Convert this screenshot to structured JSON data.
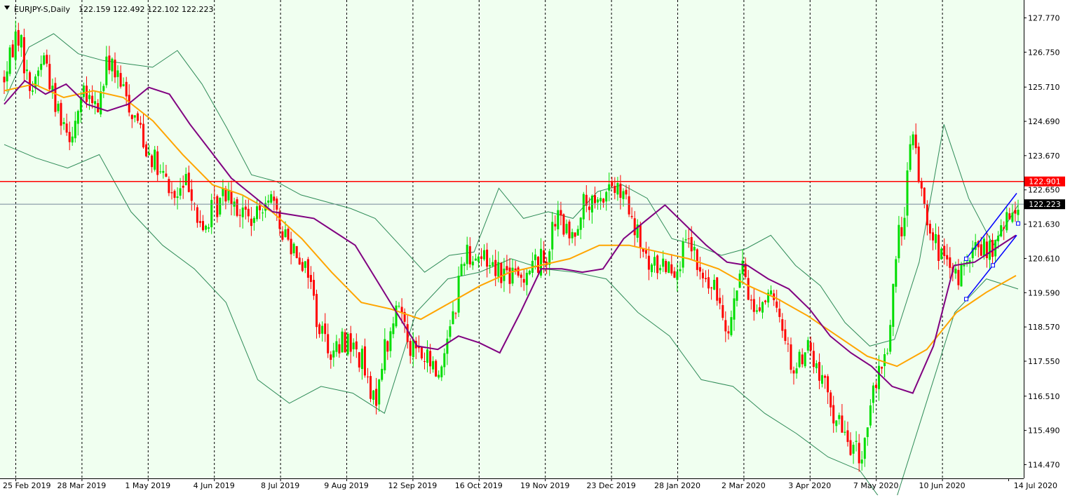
{
  "header": {
    "symbol": "EURJPY-S,Daily",
    "ohlc": "122.159 122.492 122.102 122.223",
    "menu_icon": "triangle-down-icon"
  },
  "colors": {
    "background": "#f0fff0",
    "grid": "#000000",
    "candle_up": "#00dd00",
    "candle_down": "#ff0000",
    "ma_fast": "#800080",
    "ma_slow": "#ffa500",
    "bollinger": "#2e8b57",
    "resistance": "#ff0000",
    "channel": "#0000ff",
    "price_tag": "#000000"
  },
  "chart_data": {
    "type": "candlestick",
    "instrument": "EURJPY-S",
    "timeframe": "Daily",
    "y_ticks": [
      "127.770",
      "126.750",
      "125.710",
      "124.690",
      "123.670",
      "122.650",
      "121.630",
      "120.610",
      "119.590",
      "118.570",
      "117.550",
      "116.510",
      "115.490",
      "114.470"
    ],
    "ylim": [
      114.0,
      128.3
    ],
    "x_ticks": [
      "25 Feb 2019",
      "28 Mar 2019",
      "1 May 2019",
      "4 Jun 2019",
      "8 Jul 2019",
      "9 Aug 2019",
      "12 Sep 2019",
      "16 Oct 2019",
      "19 Nov 2019",
      "23 Dec 2019",
      "28 Jan 2020",
      "2 Mar 2020",
      "3 Apr 2020",
      "7 May 2020",
      "10 Jun 2020",
      "14 Jul 2020"
    ],
    "grid": "vertical dotted",
    "resistance_level": "122.901",
    "current_price": "122.223",
    "price_path": [
      126.0,
      127.3,
      125.7,
      126.6,
      125.1,
      124.4,
      125.4,
      125.1,
      126.5,
      125.6,
      124.8,
      123.8,
      123.0,
      122.4,
      122.9,
      121.4,
      122.1,
      122.7,
      122.0,
      121.7,
      122.6,
      121.5,
      121.0,
      120.3,
      118.5,
      117.8,
      118.2,
      117.7,
      116.3,
      118.0,
      119.2,
      118.0,
      117.6,
      117.2,
      118.9,
      120.8,
      120.7,
      120.5,
      120.2,
      120.0,
      120.4,
      120.6,
      121.8,
      121.2,
      122.2,
      122.1,
      122.8,
      122.4,
      121.3,
      120.3,
      120.5,
      120.4,
      121.0,
      120.0,
      119.6,
      118.7,
      120.2,
      119.1,
      119.5,
      118.7,
      117.3,
      118.0,
      117.0,
      116.0,
      115.2,
      114.7,
      116.5,
      117.9,
      121.3,
      124.1,
      122.0,
      120.8,
      120.0,
      120.3,
      121.0,
      120.8,
      121.6,
      122.223
    ],
    "ma_fast_path": [
      125.2,
      125.9,
      125.5,
      125.8,
      125.2,
      125.0,
      125.2,
      125.7,
      125.5,
      124.6,
      123.8,
      123.0,
      122.5,
      122.0,
      121.9,
      121.8,
      121.4,
      121.0,
      120.0,
      119.0,
      118.0,
      117.9,
      118.3,
      118.1,
      117.8,
      119.0,
      120.3,
      120.3,
      120.2,
      120.3,
      121.2,
      121.7,
      122.2,
      121.6,
      121.0,
      120.5,
      120.4,
      120.0,
      119.7,
      119.1,
      118.3,
      117.8,
      117.4,
      116.8,
      116.6,
      118.0,
      120.4,
      120.5,
      120.9,
      121.3
    ],
    "ma_slow_path": [
      125.6,
      125.8,
      125.4,
      125.6,
      125.4,
      124.7,
      123.7,
      122.8,
      122.5,
      122.0,
      121.2,
      120.2,
      119.3,
      119.1,
      118.8,
      119.3,
      119.8,
      120.2,
      120.4,
      120.6,
      121.0,
      121.0,
      120.8,
      120.6,
      120.3,
      119.8,
      119.4,
      118.9,
      118.3,
      117.7,
      117.4,
      117.9,
      119.0,
      119.6,
      120.1
    ],
    "bollinger_upper_path": [
      125.3,
      126.9,
      127.3,
      126.7,
      126.5,
      126.4,
      126.3,
      126.8,
      125.8,
      124.5,
      123.1,
      122.9,
      122.5,
      122.3,
      122.1,
      121.8,
      121.0,
      120.2,
      120.7,
      120.8,
      122.7,
      121.8,
      122.0,
      121.8,
      122.6,
      122.8,
      122.4,
      121.2,
      121.0,
      120.7,
      120.9,
      121.3,
      120.4,
      119.8,
      118.7,
      118.0,
      118.2,
      120.5,
      124.6,
      122.4,
      121.0,
      122.2
    ],
    "bollinger_lower_path": [
      124.0,
      123.6,
      123.3,
      123.7,
      122.0,
      121.0,
      120.3,
      119.3,
      117.0,
      116.3,
      116.8,
      116.6,
      116.0,
      119.0,
      120.0,
      120.2,
      120.6,
      120.3,
      120.2,
      120.0,
      119.0,
      118.3,
      117.0,
      116.8,
      116.0,
      115.4,
      114.7,
      114.3,
      113.0,
      116.0,
      119.0,
      120.0,
      119.7
    ],
    "channel": {
      "upper": [
        120.6,
        122.55
      ],
      "lower": [
        119.4,
        121.3
      ]
    }
  }
}
